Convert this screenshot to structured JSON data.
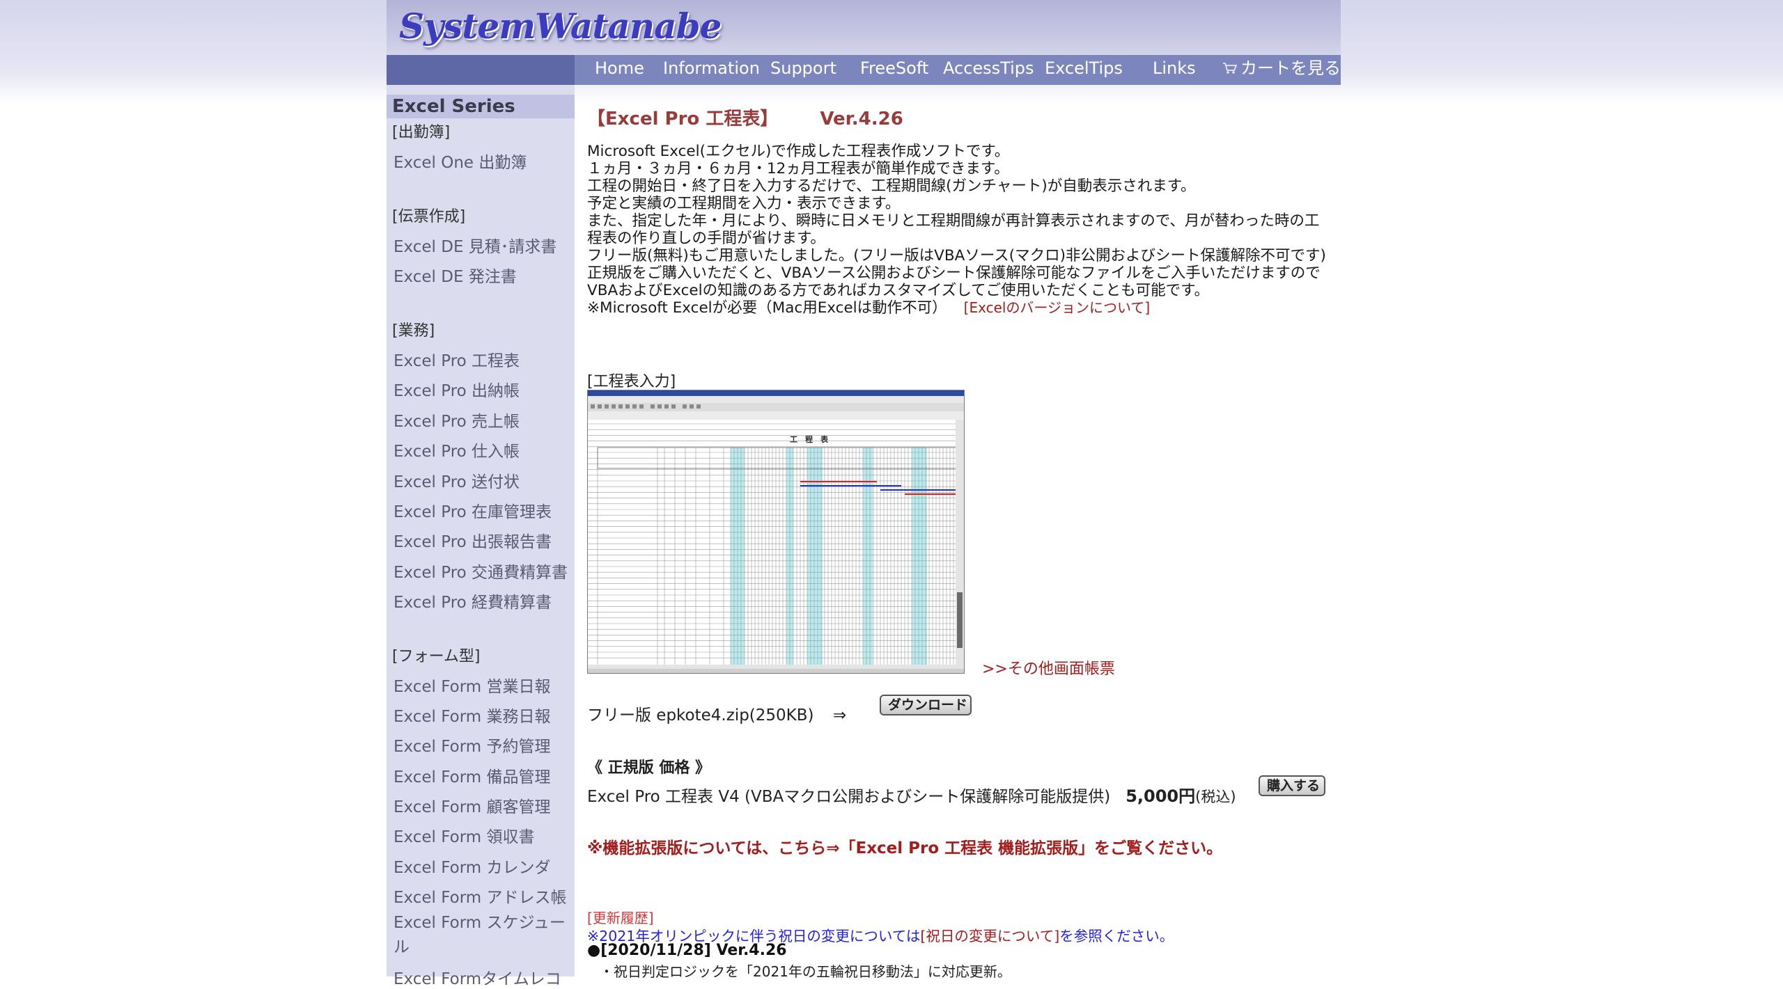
{
  "header": {
    "logo_text": "SystemWatanabe",
    "nav": [
      {
        "label": "Home"
      },
      {
        "label": "Information"
      },
      {
        "label": "Support"
      },
      {
        "label": "FreeSoft"
      },
      {
        "label": "AccessTips"
      },
      {
        "label": "ExcelTips"
      },
      {
        "label": "Links"
      }
    ],
    "cart_label": "カートを見る",
    "cart_icon": "cart-icon"
  },
  "sidebar": {
    "heading": "Excel Series",
    "groups": [
      {
        "category": "[出勤簿]",
        "items": [
          "Excel One 出勤簿"
        ]
      },
      {
        "category": "[伝票作成]",
        "items": [
          "Excel DE 見積･請求書",
          "Excel DE 発注書"
        ]
      },
      {
        "category": "[業務]",
        "items": [
          "Excel Pro 工程表",
          "Excel Pro 出納帳",
          "Excel Pro 売上帳",
          "Excel Pro 仕入帳",
          "Excel Pro 送付状",
          "Excel Pro 在庫管理表",
          "Excel Pro 出張報告書",
          "Excel Pro 交通費精算書",
          "Excel Pro 経費精算書"
        ]
      },
      {
        "category": "[フォーム型]",
        "items": [
          "Excel Form 営業日報",
          "Excel Form 業務日報",
          "Excel Form 予約管理",
          "Excel Form 備品管理",
          "Excel Form 顧客管理",
          "Excel Form 領収書",
          "Excel Form カレンダ",
          "Excel Form アドレス帳",
          "Excel Form スケジュール",
          "Excel Formタイムレコ"
        ]
      }
    ]
  },
  "main": {
    "title": "【Excel Pro 工程表】",
    "version": "Ver.4.26",
    "description": [
      "Microsoft Excel(エクセル)で作成した工程表作成ソフトです。",
      "１ヵ月・３ヵ月・６ヵ月・12ヵ月工程表が簡単作成できます。",
      "工程の開始日・終了日を入力するだけで、工程期間線(ガンチャート)が自動表示されます。",
      "予定と実績の工程期間を入力・表示できます。",
      "また、指定した年・月により、瞬時に日メモリと工程期間線が再計算表示されますので、月が替わった時の工程表の作り直しの手間が省けます。",
      "フリー版(無料)もご用意いたしました。(フリー版はVBAソース(マクロ)非公開およびシート保護解除不可です)",
      "正規版をご購入いただくと、VBAソース公開およびシート保護解除可能なファイルをご入手いただけますので VBAおよびExcelの知識のある方であればカスタマイズしてご使用いただくことも可能です。"
    ],
    "requirement": "※Microsoft Excelが必要（Mac用Excelは動作不可）",
    "version_link": "[Excelのバージョンについて]",
    "screenshot_label": "[工程表入力]",
    "screenshot_sheet_title": "工　程　表",
    "more_link": ">>その他画面帳票",
    "free": {
      "label": "フリー版 epkote4.zip(250KB)",
      "arrow": "⇒",
      "download_button": "ダウンロード"
    },
    "price": {
      "heading": "《 正規版 価格 》",
      "product": "Excel Pro 工程表 V4 (VBAマクロ公開およびシート保護解除可能版提供)",
      "amount": "5,000円",
      "tax": "(税込)",
      "buy_button": "購入する"
    },
    "extension_note": "※機能拡張版については、こちら⇒「Excel Pro 工程表 機能拡張版」をご覧ください。",
    "history": {
      "label": "[更新履歴]",
      "note_prefix": "※2021年オリンピックに伴う祝日の変更については",
      "note_link": "[祝日の変更について]",
      "note_suffix": "を参照ください。",
      "version_entry": "●[2020/11/28] Ver.4.26",
      "item": "・祝日判定ロジックを「2021年の五輪祝日移動法」に対応更新。"
    }
  },
  "colors": {
    "nav_bg": "#7d86bc",
    "sidebar_bg": "#dcdcef",
    "accent_red": "#a31d1d",
    "link_blue": "#2222dd"
  }
}
